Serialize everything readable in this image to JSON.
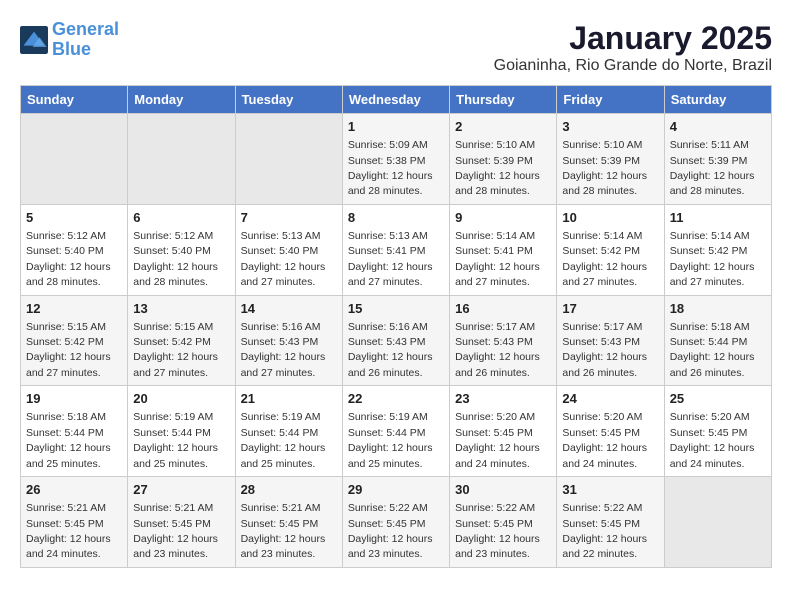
{
  "header": {
    "logo_line1": "General",
    "logo_line2": "Blue",
    "title": "January 2025",
    "subtitle": "Goianinha, Rio Grande do Norte, Brazil"
  },
  "days_of_week": [
    "Sunday",
    "Monday",
    "Tuesday",
    "Wednesday",
    "Thursday",
    "Friday",
    "Saturday"
  ],
  "weeks": [
    [
      {
        "day": "",
        "info": ""
      },
      {
        "day": "",
        "info": ""
      },
      {
        "day": "",
        "info": ""
      },
      {
        "day": "1",
        "info": "Sunrise: 5:09 AM\nSunset: 5:38 PM\nDaylight: 12 hours\nand 28 minutes."
      },
      {
        "day": "2",
        "info": "Sunrise: 5:10 AM\nSunset: 5:39 PM\nDaylight: 12 hours\nand 28 minutes."
      },
      {
        "day": "3",
        "info": "Sunrise: 5:10 AM\nSunset: 5:39 PM\nDaylight: 12 hours\nand 28 minutes."
      },
      {
        "day": "4",
        "info": "Sunrise: 5:11 AM\nSunset: 5:39 PM\nDaylight: 12 hours\nand 28 minutes."
      }
    ],
    [
      {
        "day": "5",
        "info": "Sunrise: 5:12 AM\nSunset: 5:40 PM\nDaylight: 12 hours\nand 28 minutes."
      },
      {
        "day": "6",
        "info": "Sunrise: 5:12 AM\nSunset: 5:40 PM\nDaylight: 12 hours\nand 28 minutes."
      },
      {
        "day": "7",
        "info": "Sunrise: 5:13 AM\nSunset: 5:40 PM\nDaylight: 12 hours\nand 27 minutes."
      },
      {
        "day": "8",
        "info": "Sunrise: 5:13 AM\nSunset: 5:41 PM\nDaylight: 12 hours\nand 27 minutes."
      },
      {
        "day": "9",
        "info": "Sunrise: 5:14 AM\nSunset: 5:41 PM\nDaylight: 12 hours\nand 27 minutes."
      },
      {
        "day": "10",
        "info": "Sunrise: 5:14 AM\nSunset: 5:42 PM\nDaylight: 12 hours\nand 27 minutes."
      },
      {
        "day": "11",
        "info": "Sunrise: 5:14 AM\nSunset: 5:42 PM\nDaylight: 12 hours\nand 27 minutes."
      }
    ],
    [
      {
        "day": "12",
        "info": "Sunrise: 5:15 AM\nSunset: 5:42 PM\nDaylight: 12 hours\nand 27 minutes."
      },
      {
        "day": "13",
        "info": "Sunrise: 5:15 AM\nSunset: 5:42 PM\nDaylight: 12 hours\nand 27 minutes."
      },
      {
        "day": "14",
        "info": "Sunrise: 5:16 AM\nSunset: 5:43 PM\nDaylight: 12 hours\nand 27 minutes."
      },
      {
        "day": "15",
        "info": "Sunrise: 5:16 AM\nSunset: 5:43 PM\nDaylight: 12 hours\nand 26 minutes."
      },
      {
        "day": "16",
        "info": "Sunrise: 5:17 AM\nSunset: 5:43 PM\nDaylight: 12 hours\nand 26 minutes."
      },
      {
        "day": "17",
        "info": "Sunrise: 5:17 AM\nSunset: 5:43 PM\nDaylight: 12 hours\nand 26 minutes."
      },
      {
        "day": "18",
        "info": "Sunrise: 5:18 AM\nSunset: 5:44 PM\nDaylight: 12 hours\nand 26 minutes."
      }
    ],
    [
      {
        "day": "19",
        "info": "Sunrise: 5:18 AM\nSunset: 5:44 PM\nDaylight: 12 hours\nand 25 minutes."
      },
      {
        "day": "20",
        "info": "Sunrise: 5:19 AM\nSunset: 5:44 PM\nDaylight: 12 hours\nand 25 minutes."
      },
      {
        "day": "21",
        "info": "Sunrise: 5:19 AM\nSunset: 5:44 PM\nDaylight: 12 hours\nand 25 minutes."
      },
      {
        "day": "22",
        "info": "Sunrise: 5:19 AM\nSunset: 5:44 PM\nDaylight: 12 hours\nand 25 minutes."
      },
      {
        "day": "23",
        "info": "Sunrise: 5:20 AM\nSunset: 5:45 PM\nDaylight: 12 hours\nand 24 minutes."
      },
      {
        "day": "24",
        "info": "Sunrise: 5:20 AM\nSunset: 5:45 PM\nDaylight: 12 hours\nand 24 minutes."
      },
      {
        "day": "25",
        "info": "Sunrise: 5:20 AM\nSunset: 5:45 PM\nDaylight: 12 hours\nand 24 minutes."
      }
    ],
    [
      {
        "day": "26",
        "info": "Sunrise: 5:21 AM\nSunset: 5:45 PM\nDaylight: 12 hours\nand 24 minutes."
      },
      {
        "day": "27",
        "info": "Sunrise: 5:21 AM\nSunset: 5:45 PM\nDaylight: 12 hours\nand 23 minutes."
      },
      {
        "day": "28",
        "info": "Sunrise: 5:21 AM\nSunset: 5:45 PM\nDaylight: 12 hours\nand 23 minutes."
      },
      {
        "day": "29",
        "info": "Sunrise: 5:22 AM\nSunset: 5:45 PM\nDaylight: 12 hours\nand 23 minutes."
      },
      {
        "day": "30",
        "info": "Sunrise: 5:22 AM\nSunset: 5:45 PM\nDaylight: 12 hours\nand 23 minutes."
      },
      {
        "day": "31",
        "info": "Sunrise: 5:22 AM\nSunset: 5:45 PM\nDaylight: 12 hours\nand 22 minutes."
      },
      {
        "day": "",
        "info": ""
      }
    ]
  ]
}
